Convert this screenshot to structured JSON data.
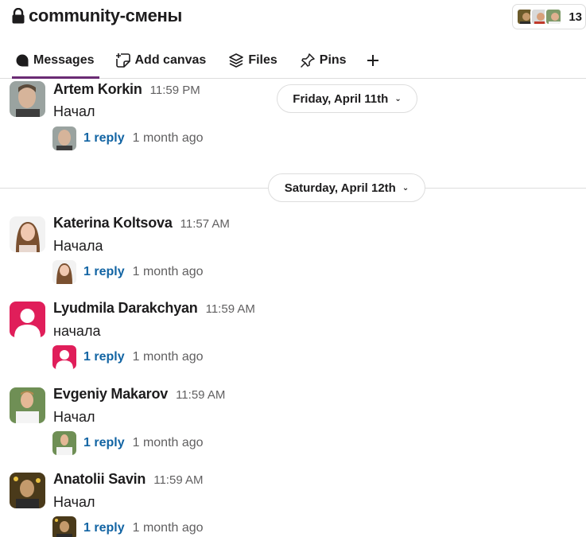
{
  "header": {
    "channel_name": "community-смены",
    "member_count": "13"
  },
  "tabs": [
    {
      "label": "Messages",
      "icon": "messages-bubble-icon"
    },
    {
      "label": "Add canvas",
      "icon": "add-canvas-icon"
    },
    {
      "label": "Files",
      "icon": "files-stack-icon"
    },
    {
      "label": "Pins",
      "icon": "pin-icon"
    },
    {
      "label": "",
      "icon": "plus-icon"
    }
  ],
  "date_dividers": [
    {
      "label": "Friday, April 11th"
    },
    {
      "label": "Saturday, April 12th"
    }
  ],
  "messages": [
    {
      "sender": "Artem Korkin",
      "time": "11:59 PM",
      "text": "Начал",
      "replies": "1 reply",
      "ago": "1 month ago"
    },
    {
      "sender": "Katerina Koltsova",
      "time": "11:57 AM",
      "text": "Начала",
      "replies": "1 reply",
      "ago": "1 month ago"
    },
    {
      "sender": "Lyudmila Darakchyan",
      "time": "11:59 AM",
      "text": "начала",
      "replies": "1 reply",
      "ago": "1 month ago"
    },
    {
      "sender": "Evgeniy Makarov",
      "time": "11:59 AM",
      "text": "Начал",
      "replies": "1 reply",
      "ago": "1 month ago"
    },
    {
      "sender": "Anatolii Savin",
      "time": "11:59 AM",
      "text": "Начал",
      "replies": "1 reply",
      "ago": "1 month ago"
    }
  ],
  "colors": {
    "accent_tab": "#6b2c74",
    "link": "#1264a3",
    "default_avatar": "#e01e5a"
  }
}
